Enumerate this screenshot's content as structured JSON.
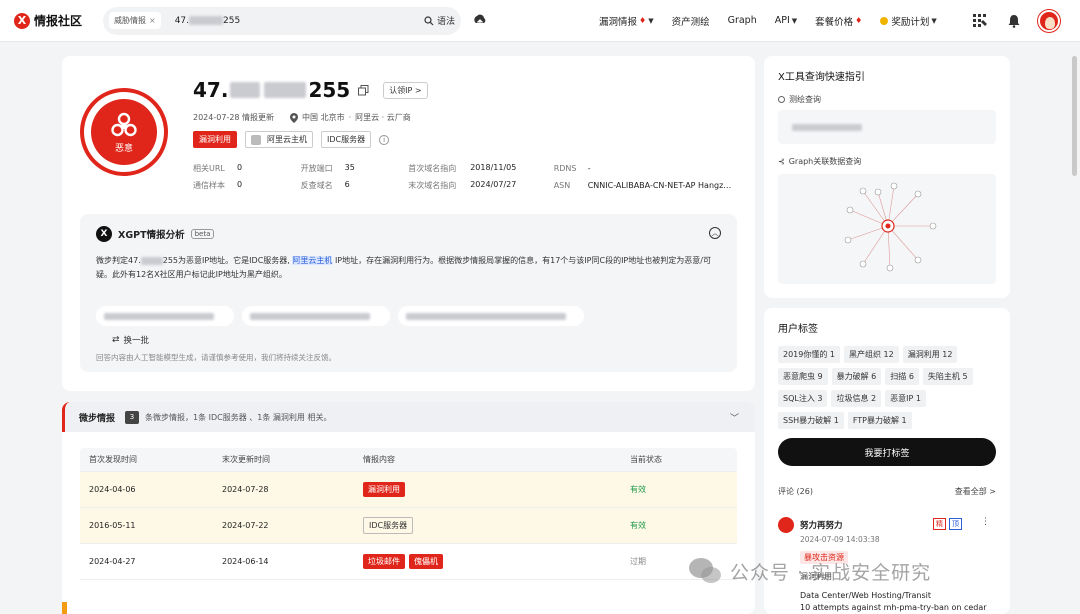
{
  "nav": {
    "logo_text": "情报社区",
    "search_chip": "威胁情报",
    "search_prefix": "47.",
    "search_suffix": "255",
    "syntax_label": "语法",
    "links": [
      {
        "label": "漏洞情报",
        "flame": true,
        "caret": true
      },
      {
        "label": "资产测绘"
      },
      {
        "label": "Graph"
      },
      {
        "label": "API",
        "caret": true
      },
      {
        "label": "套餐价格",
        "flame": true
      },
      {
        "label": "奖励计划",
        "coin": true,
        "caret": true
      }
    ]
  },
  "profile": {
    "ip_prefix": "47.",
    "ip_suffix": "255",
    "claim_label": "认领IP >",
    "seal_label": "恶意",
    "date": "2024-07-28",
    "update_text": "情报更新",
    "location": "中国 北京市",
    "provider": "阿里云 · 云厂商",
    "tag_vuln": "漏洞利用",
    "tag_cloud": "阿里云主机",
    "tag_idc": "IDC服务器",
    "stats": [
      [
        {
          "k": "相关URL",
          "v": "0"
        },
        {
          "k": "开放端口",
          "v": "35"
        },
        {
          "k": "首次域名指向",
          "v": "2018/11/05"
        },
        {
          "k": "RDNS",
          "v": "-"
        }
      ],
      [
        {
          "k": "通信样本",
          "v": "0"
        },
        {
          "k": "反查域名",
          "v": "6"
        },
        {
          "k": "末次域名指向",
          "v": "2024/07/27"
        },
        {
          "k": "ASN",
          "v": "CNNIC-ALIBABA-CN-NET-AP Hangz…"
        }
      ]
    ]
  },
  "xgpt": {
    "title": "XGPT情报分析",
    "beta": "beta",
    "body_a": "微步判定47.",
    "body_b": "255为恶意IP地址。它是IDC服务器,",
    "body_link": "阿里云主机",
    "body_c": "IP地址，存在漏洞利用行为。根据微步情报局掌握的信息，有17个与该IP同C段的IP地址也被判定为恶意/可疑。此外有12名X社区用户标记此IP地址为黑产组织。",
    "refresh": "换一批",
    "disclaimer": "回答内容由人工智能模型生成，请谨慎参考使用，我们将持续关注反馈。"
  },
  "intel": {
    "title": "微步情报",
    "count": "3",
    "summary": "条微步情报，1条 IDC服务器 、1条 漏洞利用 相关。",
    "headers": [
      "首次发现时间",
      "末次更新时间",
      "情报内容",
      "当前状态"
    ],
    "rows": [
      {
        "first": "2024-04-06",
        "last": "2024-07-28",
        "tags": [
          "漏洞利用"
        ],
        "outline": [],
        "status": "有效",
        "ok": true
      },
      {
        "first": "2016-05-11",
        "last": "2024-07-22",
        "tags": [],
        "outline": [
          "IDC服务器"
        ],
        "status": "有效",
        "ok": true
      },
      {
        "first": "2024-04-27",
        "last": "2024-06-14",
        "tags": [
          "垃圾邮件",
          "傀儡机"
        ],
        "outline": [],
        "status": "过期",
        "ok": false
      }
    ]
  },
  "quick": {
    "title": "X工具查询快速指引",
    "mapping_label": "测绘查询",
    "graph_label": "Graph关联数据查询"
  },
  "user_tags": {
    "title": "用户标签",
    "items": [
      "2019你懂的 1",
      "黑产组织 12",
      "漏洞利用 12",
      "恶意爬虫 9",
      "暴力破解 6",
      "扫描 6",
      "失陷主机 5",
      "SQL注入 3",
      "垃圾信息 2",
      "恶意IP 1",
      "SSH暴力破解 1",
      "FTP暴力破解 1"
    ],
    "button": "我要打标签",
    "comments_label": "评论 (26)",
    "view_all": "查看全部 >"
  },
  "comment": {
    "name": "努力再努力",
    "time": "2024-07-09 14:03:38",
    "badge1": "精",
    "badge2": "顶",
    "tag1": "暴攻击资源",
    "tag2": "漏洞利用",
    "line1": "Data Center/Web Hosting/Transit",
    "line2": "10 attempts against mh-pma-try-ban on cedar"
  },
  "watermark": {
    "text": "公众号 · 实战安全研究"
  },
  "colors": {
    "brand": "#e0261a",
    "ok": "#1f9a4c"
  }
}
